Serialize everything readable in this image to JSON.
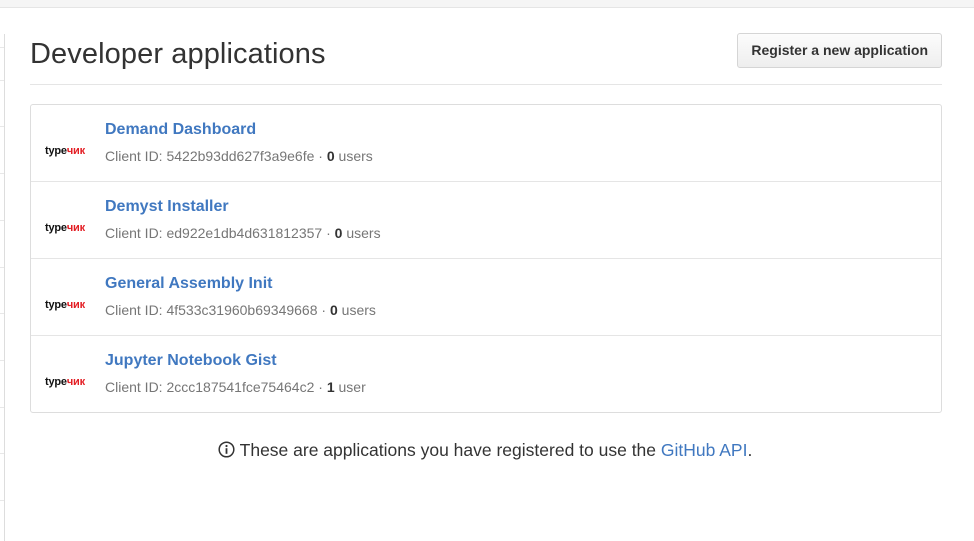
{
  "page": {
    "title": "Developer applications",
    "register_button": "Register a new application"
  },
  "logo": {
    "part_a": "type",
    "part_b": "чик"
  },
  "labels": {
    "client_id_prefix": "Client ID: ",
    "separator": " · "
  },
  "apps": [
    {
      "name": "Demand Dashboard",
      "client_id": "5422b93dd627f3a9e6fe",
      "user_count": "0",
      "user_label": " users"
    },
    {
      "name": "Demyst Installer",
      "client_id": "ed922e1db4d631812357",
      "user_count": "0",
      "user_label": " users"
    },
    {
      "name": "General Assembly Init",
      "client_id": "4f533c31960b69349668",
      "user_count": "0",
      "user_label": " users"
    },
    {
      "name": "Jupyter Notebook Gist",
      "client_id": "2ccc187541fce75464c2",
      "user_count": "1",
      "user_label": " user"
    }
  ],
  "footer": {
    "text": "These are applications you have registered to use the ",
    "link": "GitHub API",
    "end": "."
  },
  "colors": {
    "link": "#4078c0",
    "muted": "#767676",
    "logo_red": "#e31e24"
  },
  "icons": {
    "footer": "info-icon"
  }
}
